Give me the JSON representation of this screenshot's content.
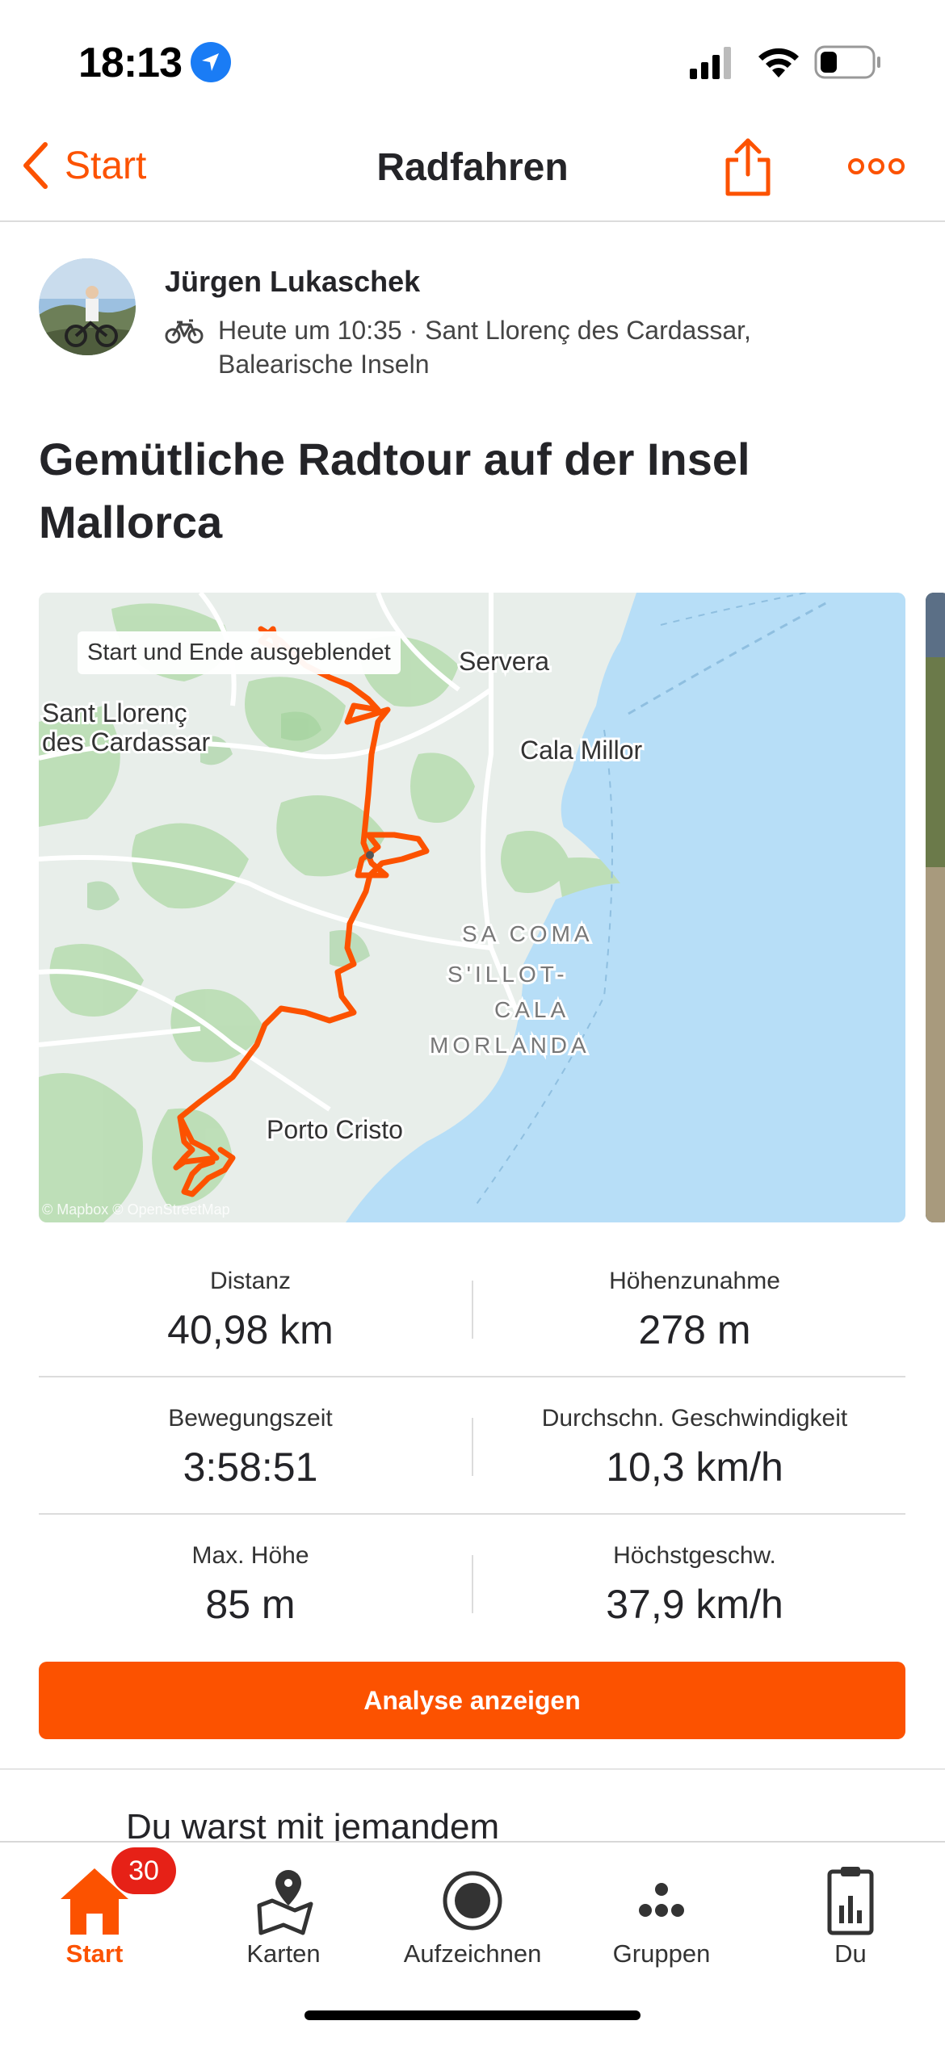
{
  "status_bar": {
    "time": "18:13"
  },
  "nav": {
    "back_label": "Start",
    "title": "Radfahren"
  },
  "activity": {
    "athlete_name": "Jürgen Lukaschek",
    "meta": "Heute um 10:35 · Sant Llorenç des Cardassar, Balearische Inseln",
    "title": "Gemütliche Radtour auf der Insel Mallorca"
  },
  "map": {
    "badge": "Start und Ende ausgeblendet",
    "labels": {
      "servera": "Servera",
      "sant_llorenc_1": "Sant Llorenç",
      "sant_llorenc_2": "des Cardassar",
      "cala_millor": "Cala Millor",
      "sa_coma": "SA COMA",
      "sillot_1": "S'ILLOT-",
      "sillot_2": "CALA",
      "sillot_3": "MORLANDA",
      "porto_cristo": "Porto Cristo"
    },
    "attribution": "© Mapbox © OpenStreetMap",
    "route_color": "#fc5200"
  },
  "stats": [
    {
      "label": "Distanz",
      "value": "40,98 km"
    },
    {
      "label": "Höhenzunahme",
      "value": "278 m"
    },
    {
      "label": "Bewegungszeit",
      "value": "3:58:51"
    },
    {
      "label": "Durchschn. Geschwindigkeit",
      "value": "10,3 km/h"
    },
    {
      "label": "Max. Höhe",
      "value": "85 m"
    },
    {
      "label": "Höchstgeschw.",
      "value": "37,9 km/h"
    }
  ],
  "analyse_button": "Analyse anzeigen",
  "with_someone": "Du warst mit jemandem",
  "tabbar": {
    "badge": "30",
    "items": [
      {
        "label": "Start",
        "icon": "home-icon",
        "active": true
      },
      {
        "label": "Karten",
        "icon": "map-pin-icon"
      },
      {
        "label": "Aufzeichnen",
        "icon": "record-icon"
      },
      {
        "label": "Gruppen",
        "icon": "groups-icon"
      },
      {
        "label": "Du",
        "icon": "clipboard-chart-icon"
      }
    ]
  },
  "colors": {
    "accent": "#fc5200",
    "badge": "#e62117",
    "water": "#b7def7"
  }
}
